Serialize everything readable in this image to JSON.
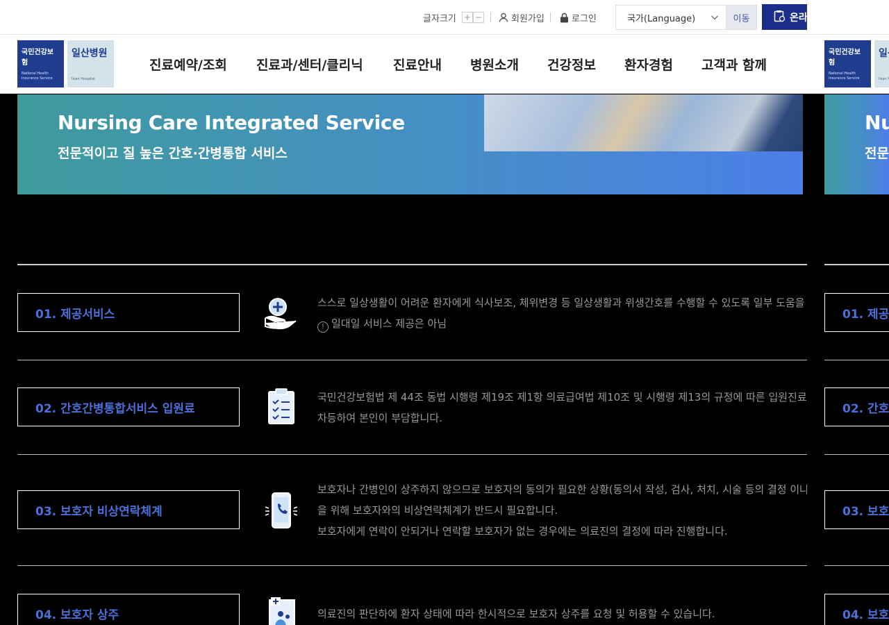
{
  "topbar": {
    "font_size_label": "글자크기",
    "font_plus": "+",
    "font_minus": "−",
    "join_label": "회원가입",
    "login_label": "로그인",
    "language_selected": "국가(Language)",
    "go_label": "이동",
    "online_label": "온라"
  },
  "logo": {
    "nhis_title": "국민건강보험",
    "nhis_sub": "National Health Insurance Service",
    "hospital_title": "일산병원",
    "hospital_sub": "Ilsan Hospital"
  },
  "nav": [
    "진료예약/조회",
    "진료과/센터/클리닉",
    "진료안내",
    "병원소개",
    "건강정보",
    "환자경험",
    "고객과 함께"
  ],
  "banner": {
    "title_en": "Nursing Care Integrated Service",
    "title_ko": "전문적이고 질 높은 간호·간병통합 서비스"
  },
  "rows": [
    {
      "label": "01. 제공서비스",
      "icon": "care-hand-icon",
      "lines": [
        "스스로 일상생활이 어려운 환자에게 식사보조, 체위변경 등 일상생활과 위생간호를 수행할 수 있도록 일부 도움을"
      ],
      "note": "일대일 서비스 제공은 아님"
    },
    {
      "label": "02. 간호간병통합서비스 입원료",
      "icon": "clipboard-icon",
      "lines": [
        "국민건강보험법 제 44조 동법 시행령 제19조 제1항 의료급여법 제10조 및 시행령 제13의 규정에 따른 입원진료",
        "차등하여 본인이 부담합니다."
      ]
    },
    {
      "label": "03. 보호자 비상연락체계",
      "icon": "phone-icon",
      "lines": [
        "보호자나 간병인이 상주하지 않으므로 보호자의 동의가 필요한 상황(동의서 작성, 검사, 처치, 시술 등의 결정 이나",
        "을 위해 보호자와의 비상연락체계가 반드시 필요합니다.",
        "보호자에게 연락이 안되거나 연락할 보호자가 없는 경우에는 의료진의 결정에 따라 진행합니다."
      ]
    },
    {
      "label": "04. 보호자 상주",
      "icon": "guardian-icon",
      "lines": [
        "의료진의 판단하에 환자 상태에 따라 한시적으로 보호자 상주를 요청 및 허용할 수 있습니다."
      ]
    }
  ],
  "colors": {
    "accent": "#4d6fd8",
    "online_button": "#1b2e8c"
  }
}
